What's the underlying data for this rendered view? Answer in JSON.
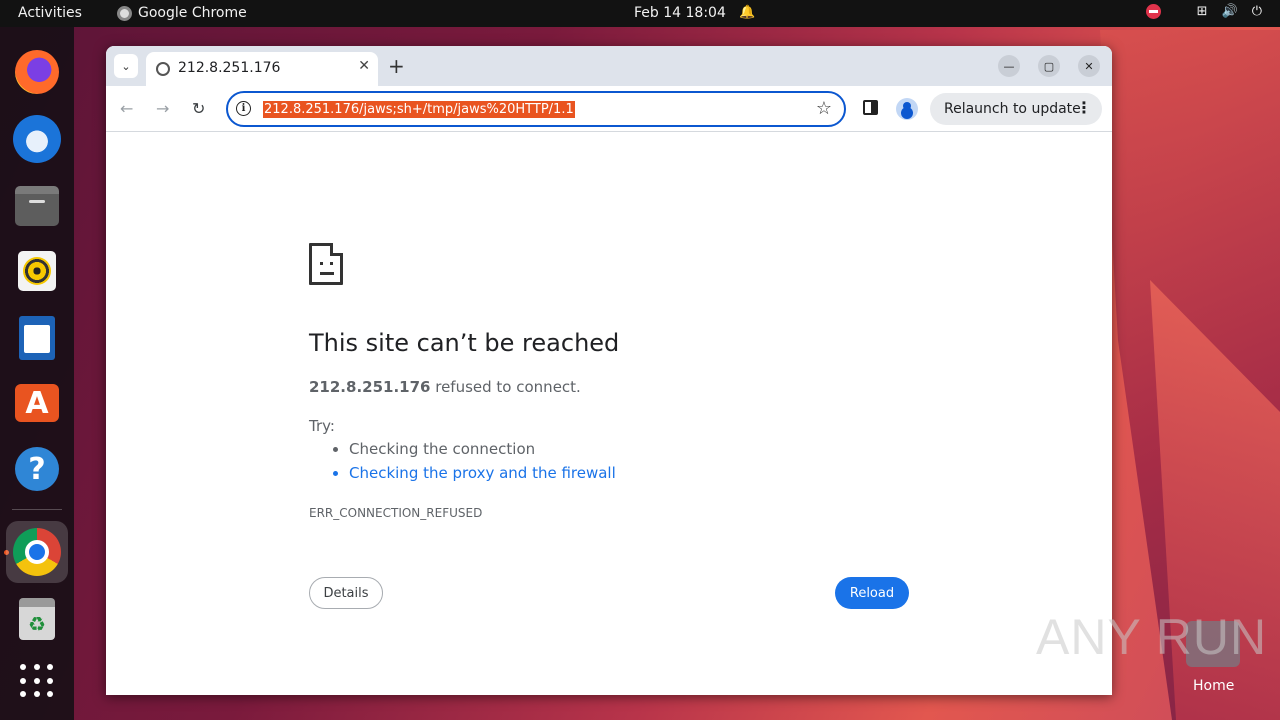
{
  "topbar": {
    "activities": "Activities",
    "app_name": "Google Chrome",
    "clock": "Feb 14  18:04"
  },
  "dock": {
    "items": [
      "firefox",
      "thunderbird",
      "files",
      "rhythmbox",
      "libreoffice-writer",
      "app-center",
      "help",
      "google-chrome",
      "trash",
      "show-apps"
    ]
  },
  "browser": {
    "tab_title": "212.8.251.176",
    "url": "212.8.251.176/jaws;sh+/tmp/jaws%20HTTP/1.1",
    "relaunch_label": "Relaunch to update"
  },
  "error_page": {
    "heading": "This site can’t be reached",
    "host": "212.8.251.176",
    "message": " refused to connect.",
    "try_label": "Try:",
    "suggestions": [
      "Checking the connection",
      "Checking the proxy and the firewall"
    ],
    "error_code": "ERR_CONNECTION_REFUSED",
    "details_button": "Details",
    "reload_button": "Reload"
  },
  "desktop": {
    "home_label": "Home",
    "watermark": "ANY RUN"
  },
  "colors": {
    "accent": "#1a73e8",
    "selection": "#e95420",
    "omnibox_focus": "#0b57d0"
  }
}
